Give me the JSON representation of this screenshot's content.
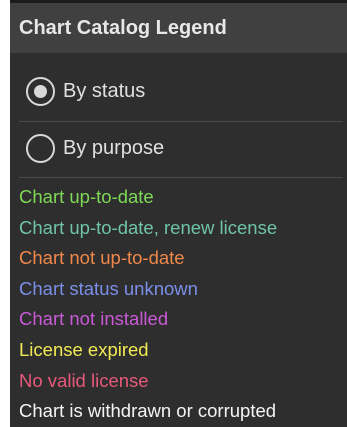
{
  "header": {
    "title": "Chart Catalog Legend"
  },
  "options": [
    {
      "label": "By status",
      "selected": true
    },
    {
      "label": "By purpose",
      "selected": false
    }
  ],
  "legend": [
    {
      "label": "Chart up-to-date",
      "color": "#7ed957"
    },
    {
      "label": "Chart up-to-date, renew license",
      "color": "#6fc4a8"
    },
    {
      "label": "Chart not up-to-date",
      "color": "#f0884a"
    },
    {
      "label": "Chart status unknown",
      "color": "#7a8fe8"
    },
    {
      "label": "Chart not installed",
      "color": "#c85ad6"
    },
    {
      "label": "License expired",
      "color": "#f2ea54"
    },
    {
      "label": "No valid license",
      "color": "#e8587a"
    },
    {
      "label": "Chart is withdrawn or corrupted",
      "color": "#f4f4f4"
    }
  ]
}
